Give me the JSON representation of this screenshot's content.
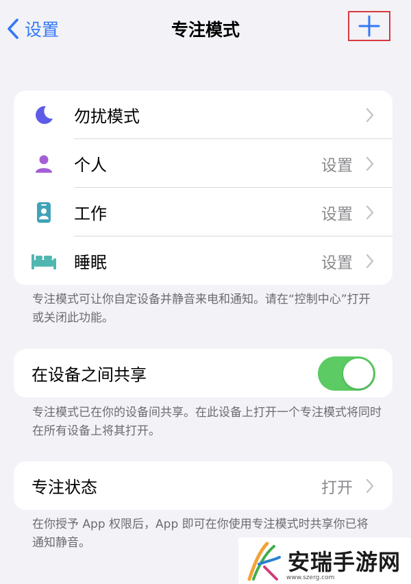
{
  "nav": {
    "back_label": "设置",
    "title": "专注模式"
  },
  "focus_modes": [
    {
      "label": "勿扰模式",
      "value": "",
      "icon": "moon-icon",
      "icon_color": "#5e5ce6"
    },
    {
      "label": "个人",
      "value": "设置",
      "icon": "person-icon",
      "icon_color": "#a55fd6"
    },
    {
      "label": "工作",
      "value": "设置",
      "icon": "id-badge-icon",
      "icon_color": "#41a3b8"
    },
    {
      "label": "睡眠",
      "value": "设置",
      "icon": "bed-icon",
      "icon_color": "#50b7b0"
    }
  ],
  "focus_modes_footer": "专注模式可让你自定设备并静音来电和通知。请在“控制中心”打开或关闭此功能。",
  "share": {
    "label": "在设备之间共享",
    "toggle_on": true,
    "footer": "专注模式已在你的设备间共享。在此设备上打开一个专注模式将同时在所有设备上将其打开。"
  },
  "focus_status": {
    "label": "专注状态",
    "value": "打开",
    "footer": "在你授予 App 权限后，App 即可在你使用专注模式时共享你已将通知静音。"
  },
  "watermark": {
    "text": "安瑞手游网",
    "url": "www.szerg.com"
  },
  "colors": {
    "accent": "#3478f6",
    "toggle_on": "#5ccb63",
    "highlight_box": "#d8383d"
  }
}
